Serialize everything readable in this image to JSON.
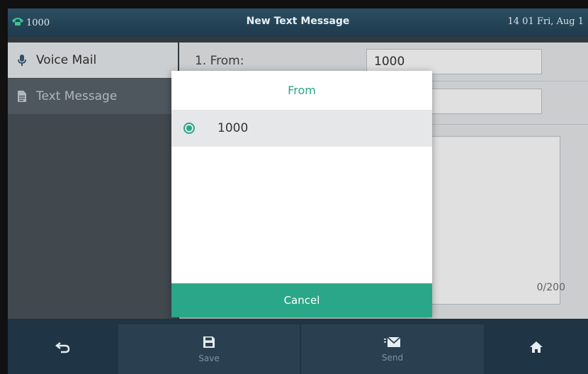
{
  "status_bar": {
    "line": "1000",
    "title": "New Text Message",
    "datetime": "14 01 Fri, Aug 1"
  },
  "sidebar": {
    "items": [
      {
        "label": "Voice Mail",
        "icon": "microphone-icon",
        "selected": true
      },
      {
        "label": "Text Message",
        "icon": "document-icon",
        "selected": false
      }
    ]
  },
  "form": {
    "from_label": "1. From:",
    "from_value": "1000",
    "counter": "0/200"
  },
  "dialog": {
    "title": "From",
    "options": [
      {
        "label": "1000",
        "selected": true
      }
    ],
    "cancel_label": "Cancel"
  },
  "softkeys": {
    "back_icon": "back-arrow-icon",
    "save_label": "Save",
    "send_label": "Send",
    "home_icon": "home-icon"
  },
  "colors": {
    "accent": "#2aa788",
    "status_bar": "#2c4e63",
    "softkey_bar": "#1f3444"
  }
}
